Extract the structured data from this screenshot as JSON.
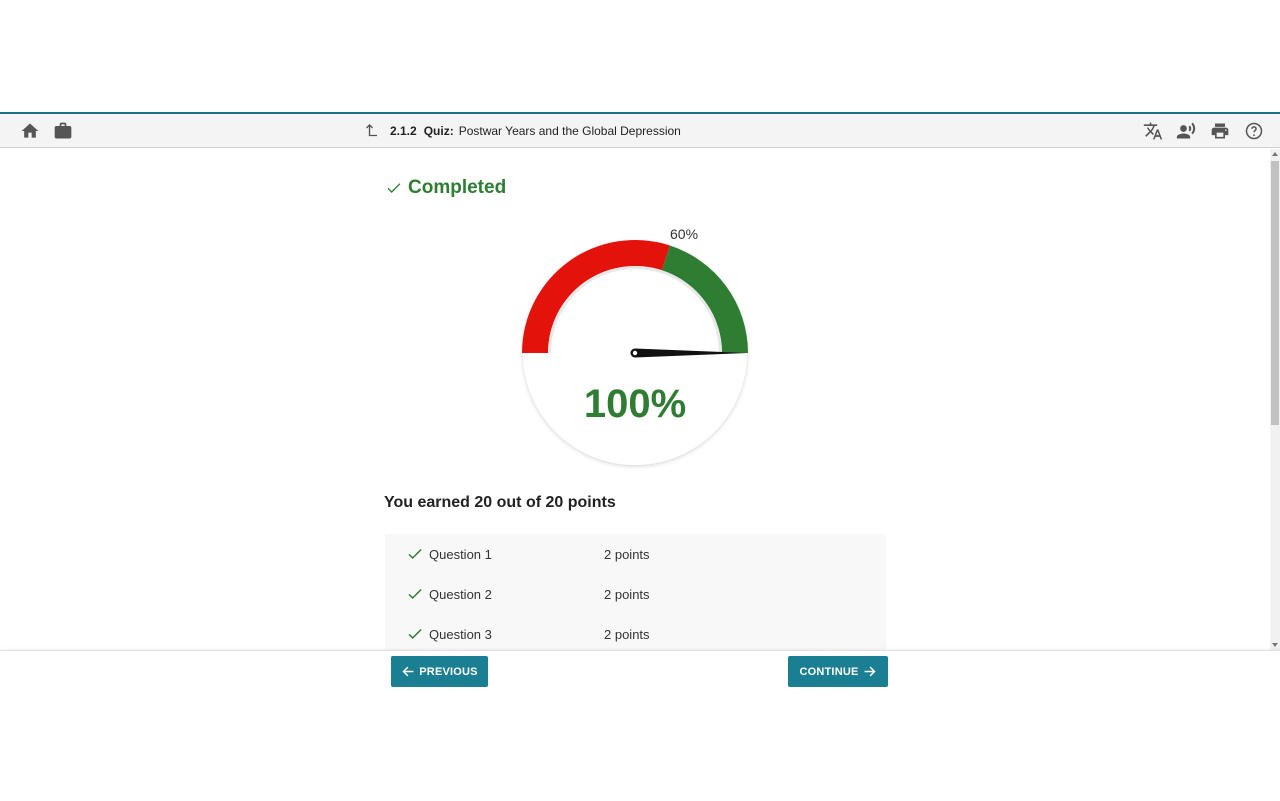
{
  "toolbar": {
    "left_icons": [
      "home-icon",
      "briefcase-icon"
    ],
    "breadcrumb": {
      "number": "2.1.2",
      "type": "Quiz:",
      "title": "Postwar Years and the Global Depression"
    },
    "right_icons": [
      "translate-icon",
      "read-aloud-icon",
      "print-icon",
      "help-icon"
    ]
  },
  "result": {
    "status": "Completed",
    "threshold_label": "60%",
    "threshold_fraction": 0.6,
    "score_label": "100%",
    "score_fraction": 1.0,
    "earned_text": "You earned 20 out of 20 points"
  },
  "questions": [
    {
      "label": "Question 1",
      "points": "2 points",
      "correct": true
    },
    {
      "label": "Question 2",
      "points": "2 points",
      "correct": true
    },
    {
      "label": "Question 3",
      "points": "2 points",
      "correct": true
    }
  ],
  "footer": {
    "previous_label": "PREVIOUS",
    "continue_label": "CONTINUE"
  },
  "colors": {
    "accent": "#1b7f93",
    "success": "#2e7d32",
    "fail": "#e3120b"
  }
}
